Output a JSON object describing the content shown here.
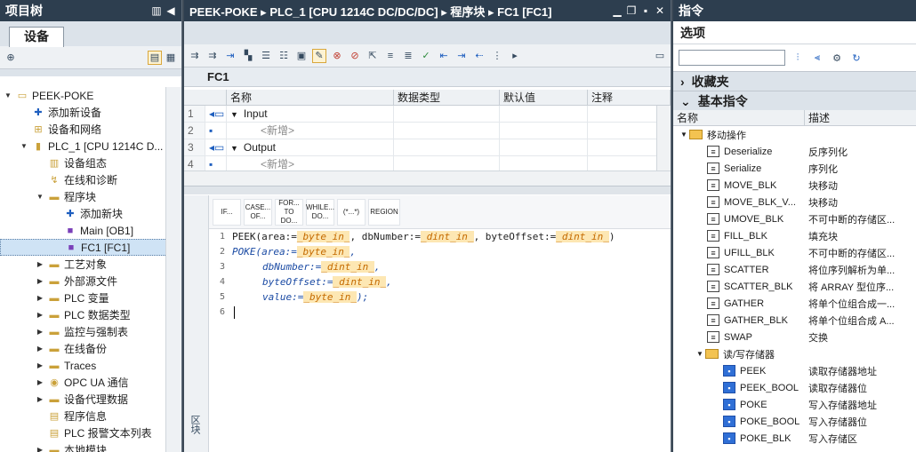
{
  "left": {
    "title": "项目树",
    "tab_label": "设备",
    "tree": [
      {
        "depth": 0,
        "tw": "▼",
        "icon": "project-icon",
        "glyph": "▭",
        "label": "PEEK-POKE"
      },
      {
        "depth": 1,
        "tw": "",
        "icon": "add-device-icon",
        "glyph": "✚",
        "label": "添加新设备"
      },
      {
        "depth": 1,
        "tw": "",
        "icon": "network-icon",
        "glyph": "⊞",
        "label": "设备和网络"
      },
      {
        "depth": 1,
        "tw": "▼",
        "icon": "plc-icon",
        "glyph": "▮",
        "label": "PLC_1 [CPU 1214C D..."
      },
      {
        "depth": 2,
        "tw": "",
        "icon": "device-config-icon",
        "glyph": "▥",
        "label": "设备组态"
      },
      {
        "depth": 2,
        "tw": "",
        "icon": "diagnostics-icon",
        "glyph": "↯",
        "label": "在线和诊断"
      },
      {
        "depth": 2,
        "tw": "▼",
        "icon": "program-blocks-folder-icon",
        "glyph": "▬",
        "label": "程序块"
      },
      {
        "depth": 3,
        "tw": "",
        "icon": "add-block-icon",
        "glyph": "✚",
        "label": "添加新块"
      },
      {
        "depth": 3,
        "tw": "",
        "icon": "ob-block-icon",
        "glyph": "■",
        "label": "Main [OB1]"
      },
      {
        "depth": 3,
        "tw": "",
        "icon": "fc-block-icon",
        "glyph": "■",
        "label": "FC1 [FC1]",
        "selected": true
      },
      {
        "depth": 2,
        "tw": "▶",
        "icon": "technology-icon",
        "glyph": "▬",
        "label": "工艺对象"
      },
      {
        "depth": 2,
        "tw": "▶",
        "icon": "external-source-icon",
        "glyph": "▬",
        "label": "外部源文件"
      },
      {
        "depth": 2,
        "tw": "▶",
        "icon": "plc-tags-icon",
        "glyph": "▬",
        "label": "PLC 变量"
      },
      {
        "depth": 2,
        "tw": "▶",
        "icon": "plc-datatypes-icon",
        "glyph": "▬",
        "label": "PLC 数据类型"
      },
      {
        "depth": 2,
        "tw": "▶",
        "icon": "watch-force-icon",
        "glyph": "▬",
        "label": "监控与强制表"
      },
      {
        "depth": 2,
        "tw": "▶",
        "icon": "online-backup-icon",
        "glyph": "▬",
        "label": "在线备份"
      },
      {
        "depth": 2,
        "tw": "▶",
        "icon": "traces-icon",
        "glyph": "▬",
        "label": "Traces"
      },
      {
        "depth": 2,
        "tw": "▶",
        "icon": "opcua-icon",
        "glyph": "◉",
        "label": "OPC UA 通信"
      },
      {
        "depth": 2,
        "tw": "▶",
        "icon": "device-proxy-icon",
        "glyph": "▬",
        "label": "设备代理数据"
      },
      {
        "depth": 2,
        "tw": "",
        "icon": "program-info-icon",
        "glyph": "▤",
        "label": "程序信息"
      },
      {
        "depth": 2,
        "tw": "",
        "icon": "alarm-text-icon",
        "glyph": "▤",
        "label": "PLC 报警文本列表"
      },
      {
        "depth": 2,
        "tw": "▶",
        "icon": "local-modules-icon",
        "glyph": "▬",
        "label": "本地模块"
      }
    ]
  },
  "center": {
    "breadcrumb": "PEEK-POKE ▸ PLC_1 [CPU 1214C DC/DC/DC] ▸ 程序块 ▸ FC1 [FC1]",
    "block_name": "FC1",
    "columns": {
      "name": "名称",
      "datatype": "数据类型",
      "default": "默认值",
      "comment": "注释"
    },
    "rows": [
      {
        "num": "1",
        "tw": "▼",
        "name": "Input",
        "placeholder": false
      },
      {
        "num": "2",
        "tw": "",
        "name": "<新增>",
        "placeholder": true
      },
      {
        "num": "3",
        "tw": "▼",
        "name": "Output",
        "placeholder": false
      },
      {
        "num": "4",
        "tw": "",
        "name": "<新增>",
        "placeholder": true
      }
    ],
    "scl_buttons": [
      "IF...",
      "CASE... OF...",
      "FOR... TO DO...",
      "WHILE... DO...",
      "(*...*)",
      "REGION"
    ],
    "side_strip_label": "区块",
    "code": {
      "line1": {
        "num": "1",
        "fn": "PEEK",
        "a1": "(area:=",
        "t1": "_byte_in_",
        "a2": ", dbNumber:=",
        "t2": "_dint_in_",
        "a3": ", byteOffset:=",
        "t3": "_dint_in_",
        "a4": ")"
      },
      "line2": {
        "num": "2",
        "fn": "POKE",
        "a1": "(area:=",
        "t1": "_byte_in_",
        "a2": ","
      },
      "line3": {
        "num": "3",
        "a1": "dbNumber:=",
        "t1": "_dint_in_",
        "a2": ","
      },
      "line4": {
        "num": "4",
        "a1": "byteOffset:=",
        "t1": "_dint_in_",
        "a2": ","
      },
      "line5": {
        "num": "5",
        "a1": "value:=",
        "t1": "_byte_in_",
        "a2": ");"
      },
      "line6": {
        "num": "6"
      }
    }
  },
  "right": {
    "title": "指令",
    "options_label": "选项",
    "favorites_label": "收藏夹",
    "basic_label": "基本指令",
    "col_name": "名称",
    "col_desc": "描述",
    "items": [
      {
        "kind": "folder",
        "depth": 0,
        "tw": "▼",
        "name": "移动操作",
        "desc": ""
      },
      {
        "kind": "item",
        "icon": "box",
        "name": "Deserialize",
        "desc": "反序列化"
      },
      {
        "kind": "item",
        "icon": "box",
        "name": "Serialize",
        "desc": "序列化"
      },
      {
        "kind": "item",
        "icon": "box",
        "name": "MOVE_BLK",
        "desc": "块移动"
      },
      {
        "kind": "item",
        "icon": "box",
        "name": "MOVE_BLK_V...",
        "desc": "块移动"
      },
      {
        "kind": "item",
        "icon": "box",
        "name": "UMOVE_BLK",
        "desc": "不可中断的存储区..."
      },
      {
        "kind": "item",
        "icon": "box",
        "name": "FILL_BLK",
        "desc": "填充块"
      },
      {
        "kind": "item",
        "icon": "box",
        "name": "UFILL_BLK",
        "desc": "不可中断的存储区..."
      },
      {
        "kind": "item",
        "icon": "box",
        "name": "SCATTER",
        "desc": "将位序列解析为单..."
      },
      {
        "kind": "item",
        "icon": "box",
        "name": "SCATTER_BLK",
        "desc": "将 ARRAY 型位序..."
      },
      {
        "kind": "item",
        "icon": "box",
        "name": "GATHER",
        "desc": "将单个位组合成一..."
      },
      {
        "kind": "item",
        "icon": "box",
        "name": "GATHER_BLK",
        "desc": "将单个位组合成 A..."
      },
      {
        "kind": "item",
        "icon": "box",
        "name": "SWAP",
        "desc": "交换"
      },
      {
        "kind": "folder",
        "depth": 1,
        "tw": "▼",
        "name": "读/写存储器",
        "desc": ""
      },
      {
        "kind": "item2",
        "icon": "blue",
        "name": "PEEK",
        "desc": "读取存储器地址"
      },
      {
        "kind": "item2",
        "icon": "blue",
        "name": "PEEK_BOOL",
        "desc": "读取存储器位"
      },
      {
        "kind": "item2",
        "icon": "blue",
        "name": "POKE",
        "desc": "写入存储器地址"
      },
      {
        "kind": "item2",
        "icon": "blue",
        "name": "POKE_BOOL",
        "desc": "写入存储器位"
      },
      {
        "kind": "item2",
        "icon": "blue",
        "name": "POKE_BLK",
        "desc": "写入存储区"
      }
    ]
  }
}
